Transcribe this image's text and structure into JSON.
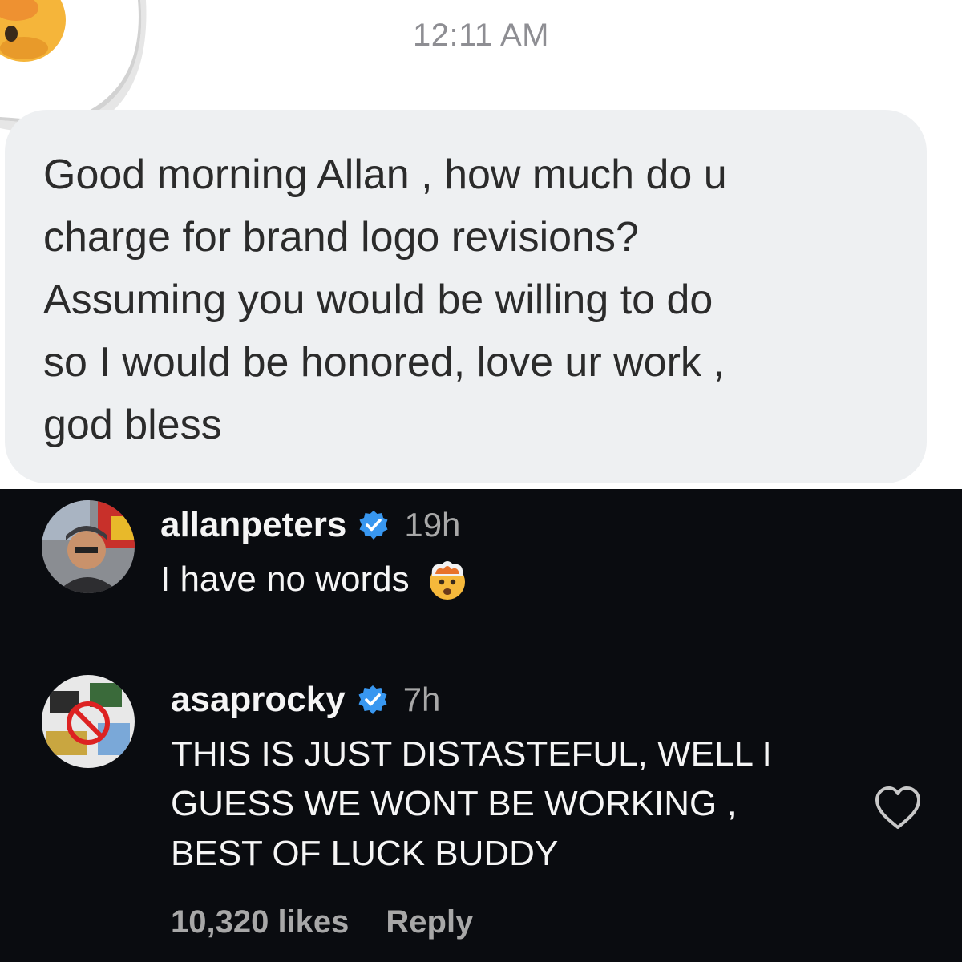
{
  "dm": {
    "time": "12:11 AM",
    "message": "Good morning Allan , how much do u\ncharge for brand logo revisions?\nAssuming you would be willing to do\nso I would be honored, love ur work ,\ngod bless"
  },
  "comments": [
    {
      "username": "allanpeters",
      "verified": true,
      "age": "19h",
      "text": "I have no words",
      "emoji": "exploding-head-icon"
    },
    {
      "username": "asaprocky",
      "verified": true,
      "age": "7h",
      "text": "THIS IS JUST DISTASTEFUL, WELL I\nGUESS WE WONT BE WORKING ,\nBEST OF LUCK BUDDY",
      "likes": "10,320 likes",
      "reply_label": "Reply"
    }
  ],
  "colors": {
    "bubble": "#eef0f2",
    "dark_background": "#0a0c10",
    "verified_badge": "#3897f0",
    "secondary_text": "#a8a8a8"
  }
}
